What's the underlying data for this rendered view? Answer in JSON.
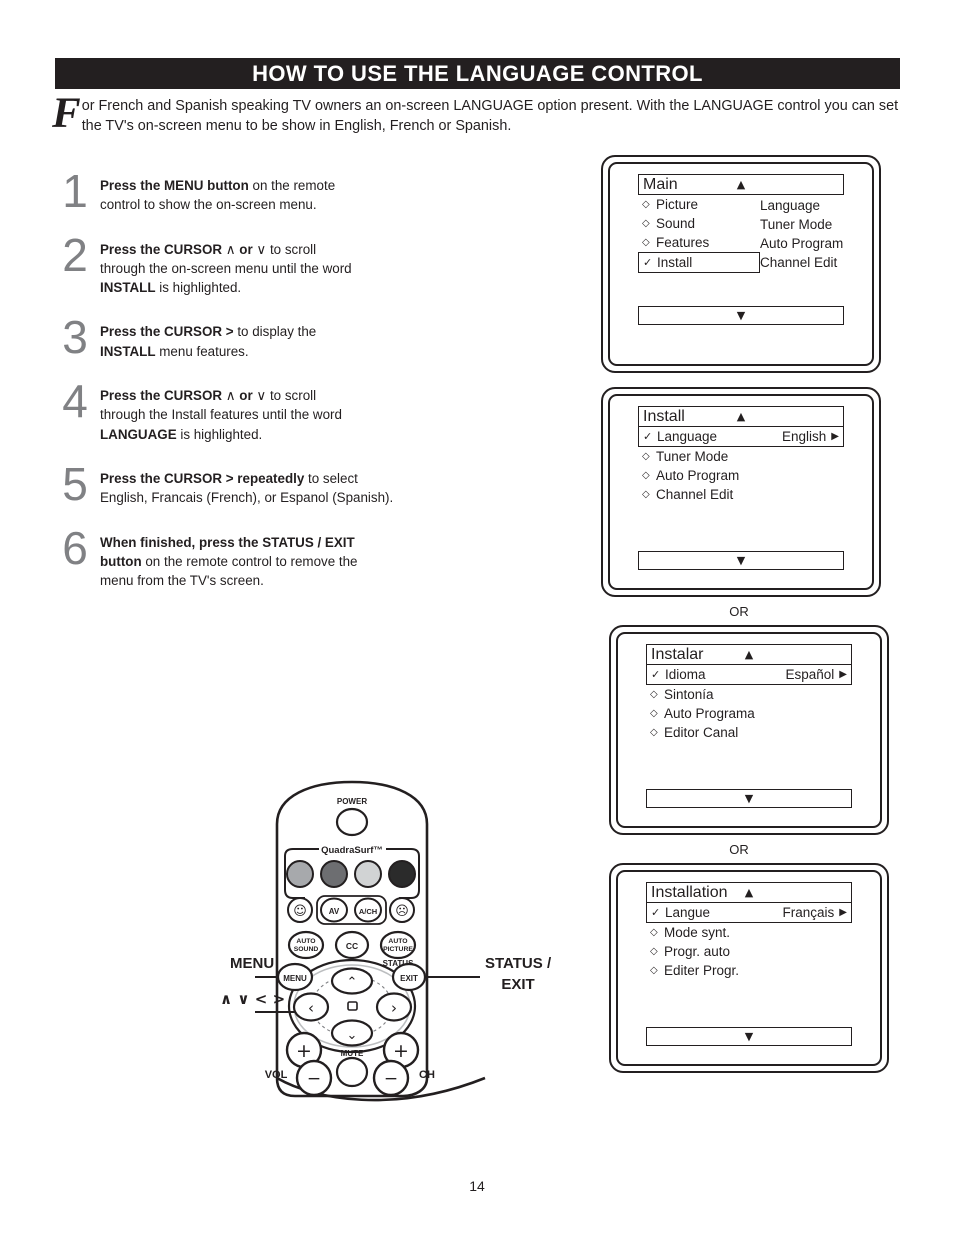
{
  "header": {
    "title": "HOW TO USE THE LANGUAGE CONTROL"
  },
  "intro": {
    "dropcap": "F",
    "text": "or French and Spanish speaking TV owners an on-screen LANGUAGE option present. With the LANGUAGE control you can set the TV's on-screen menu to be show in English, French or Spanish."
  },
  "steps": [
    {
      "number": "1",
      "lines": [
        [
          {
            "t": "Press the MENU button",
            "b": true
          },
          {
            "t": " on the remote",
            "b": false
          }
        ],
        [
          {
            "t": "control to show the on-screen menu.",
            "b": false
          }
        ]
      ]
    },
    {
      "number": "2",
      "lines": [
        [
          {
            "t": "Press the CURSOR ",
            "b": true
          },
          {
            "t": "∧",
            "b": false
          },
          {
            "t": "  or ",
            "b": true
          },
          {
            "t": "∨",
            "b": false
          },
          {
            "t": " to scroll",
            "b": false
          }
        ],
        [
          {
            "t": "through the on-screen menu until the word",
            "b": false
          }
        ],
        [
          {
            "t": "INSTALL",
            "b": true
          },
          {
            "t": " is highlighted.",
            "b": false
          }
        ]
      ]
    },
    {
      "number": "3",
      "lines": [
        [
          {
            "t": "Press the CURSOR  >",
            "b": true
          },
          {
            "t": "  to display the",
            "b": false
          }
        ],
        [
          {
            "t": "INSTALL",
            "b": true
          },
          {
            "t": " menu features.",
            "b": false
          }
        ]
      ]
    },
    {
      "number": "4",
      "lines": [
        [
          {
            "t": "Press the CURSOR ",
            "b": true
          },
          {
            "t": "∧",
            "b": false
          },
          {
            "t": "  or ",
            "b": true
          },
          {
            "t": "∨",
            "b": false
          },
          {
            "t": " to scroll",
            "b": false
          }
        ],
        [
          {
            "t": "through the Install features until the word",
            "b": false
          }
        ],
        [
          {
            "t": "LANGUAGE",
            "b": true
          },
          {
            "t": " is highlighted.",
            "b": false
          }
        ]
      ]
    },
    {
      "number": "5",
      "lines": [
        [
          {
            "t": "Press the CURSOR >  repeatedly",
            "b": true
          },
          {
            "t": " to select",
            "b": false
          }
        ],
        [
          {
            "t": "English, Francais (French), or Espanol (Spanish).",
            "b": false
          }
        ]
      ]
    },
    {
      "number": "6",
      "lines": [
        [
          {
            "t": "When finished, press the STATUS / EXIT",
            "b": true
          }
        ],
        [
          {
            "t": "button",
            "b": true
          },
          {
            "t": " on the remote control to remove the",
            "b": false
          }
        ],
        [
          {
            "t": "menu from the TV's screen.",
            "b": false
          }
        ]
      ]
    }
  ],
  "menus": {
    "main": {
      "header_label": "Main",
      "up_caret": "▲",
      "down_caret": "▼",
      "left_items": [
        {
          "marker": "◇",
          "label": "Picture",
          "highlighted": false
        },
        {
          "marker": "◇",
          "label": "Sound",
          "highlighted": false
        },
        {
          "marker": "◇",
          "label": "Features",
          "highlighted": false
        },
        {
          "marker": "✓",
          "label": "Install",
          "highlighted": true
        }
      ],
      "right_items": [
        "Language",
        "Tuner Mode",
        "Auto Program",
        "Channel Edit"
      ]
    },
    "install_en": {
      "header_label": "Install",
      "up_caret": "▲",
      "down_caret": "▼",
      "selected": {
        "marker": "✓",
        "label": "Language",
        "value": "English",
        "caret": "▶"
      },
      "items": [
        {
          "marker": "◇",
          "label": "Tuner Mode"
        },
        {
          "marker": "◇",
          "label": "Auto Program"
        },
        {
          "marker": "◇",
          "label": "Channel Edit"
        }
      ]
    },
    "install_es": {
      "header_label": "Instalar",
      "up_caret": "▲",
      "down_caret": "▼",
      "selected": {
        "marker": "✓",
        "label": "Idioma",
        "value": "Español",
        "caret": "▶"
      },
      "items": [
        {
          "marker": "◇",
          "label": "Sintonía"
        },
        {
          "marker": "◇",
          "label": "Auto Programa"
        },
        {
          "marker": "◇",
          "label": "Editor Canal"
        }
      ]
    },
    "install_fr": {
      "header_label": "Installation",
      "up_caret": "▲",
      "down_caret": "▼",
      "selected": {
        "marker": "✓",
        "label": "Langue",
        "value": "Français",
        "caret": "▶"
      },
      "items": [
        {
          "marker": "◇",
          "label": "Mode synt."
        },
        {
          "marker": "◇",
          "label": "Progr. auto"
        },
        {
          "marker": "◇",
          "label": "Editer Progr."
        }
      ]
    },
    "or_label_1": "OR",
    "or_label_2": "OR"
  },
  "remote": {
    "power_label": "POWER",
    "quadrasurf_label": "QuadraSurf™",
    "quadra_colors": [
      "#a7a9ac",
      "#6d6e71",
      "#d1d3d4",
      "#2b2b2b"
    ],
    "buttons": {
      "smile": "☺",
      "av": "AV",
      "ach": "A/CH",
      "frown": "☹",
      "auto_sound_1": "AUTO",
      "auto_sound_2": "SOUND",
      "cc": "CC",
      "auto_picture_1": "AUTO",
      "auto_picture_2": "PICTURE",
      "status": "STATUS",
      "menu": "MENU",
      "exit": "EXIT",
      "up": "∧",
      "down": "∨",
      "left": "‹",
      "right": "›",
      "mute": "MUTE",
      "vol": "VOL",
      "ch": "CH",
      "plus": "+",
      "minus": "−"
    },
    "callouts": {
      "menu": "MENU",
      "cursor": "∧ ∨ < >",
      "status_line1": "STATUS /",
      "status_line2": "EXIT"
    }
  },
  "footer": {
    "page_number": "14"
  }
}
